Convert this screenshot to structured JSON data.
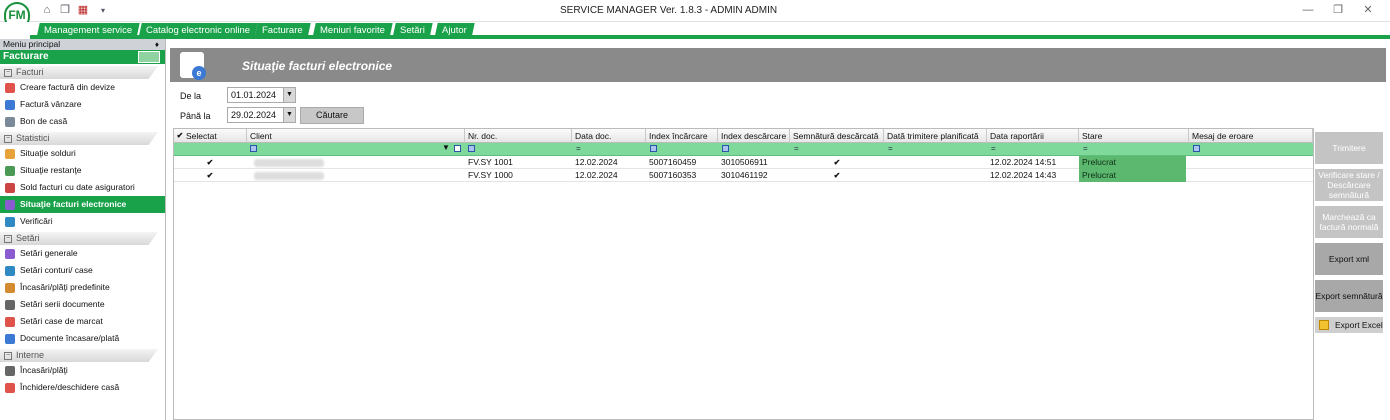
{
  "app": {
    "title": "SERVICE MANAGER Ver. 1.8.3 - ADMIN ADMIN",
    "logo_text": "FM",
    "quick_icons": [
      "home-icon",
      "copy-icon",
      "calendar-icon",
      "dropdown-icon"
    ]
  },
  "menu": [
    "Management service",
    "Catalog electronic online",
    "Facturare",
    "Meniuri favorite",
    "Setări",
    "Ajutor"
  ],
  "sidebar": {
    "header": "Meniu principal",
    "pin": "♦",
    "title": "Facturare",
    "groups": [
      {
        "label": "Facturi",
        "items": [
          "Creare factură din devize",
          "Factură vânzare",
          "Bon de casă"
        ]
      },
      {
        "label": "Statistici",
        "items": [
          "Situaţie solduri",
          "Situaţie restanţe",
          "Sold facturi cu date asiguratori",
          "Situaţie facturi electronice",
          "Verificări"
        ]
      },
      {
        "label": "Setări",
        "items": [
          "Setări generale",
          "Setări conturi/ case",
          "Încasări/plăţi predefinite",
          "Setări serii documente",
          "Setări case de marcat",
          "Documente încasare/plată"
        ]
      },
      {
        "label": "Interne",
        "items": [
          "Încasări/plăţi",
          "Închidere/deschidere casă"
        ]
      }
    ],
    "selected": "Situaţie facturi electronice"
  },
  "page": {
    "title": "Situaţie facturi electronice",
    "icon_letter": "e"
  },
  "filters": {
    "from_label": "De la",
    "from_value": "01.01.2024",
    "to_label": "Până la",
    "to_value": "29.02.2024",
    "search_button": "Căutare"
  },
  "grid": {
    "columns": [
      "Selectat",
      "Client",
      "Nr. doc.",
      "Data doc.",
      "Index încărcare",
      "Index descărcare",
      "Semnătură descărcată",
      "Dată trimitere planificată",
      "Data raportării",
      "Stare",
      "Mesaj de eroare"
    ],
    "filter_eq": "=",
    "rows": [
      {
        "nr": "FV.SY 1001",
        "data": "12.02.2024",
        "inc": "5007160459",
        "desc": "3010506911",
        "raport": "12.02.2024 14:51",
        "stare": "Prelucrat",
        "check": "✔"
      },
      {
        "nr": "FV.SY 1000",
        "data": "12.02.2024",
        "inc": "5007160353",
        "desc": "3010461192",
        "raport": "12.02.2024 14:43",
        "stare": "Prelucrat",
        "check": "✔"
      }
    ]
  },
  "actions": [
    "Trimitere",
    "Verificare stare / Descărcare semnătură",
    "Marchează ca factură normală",
    "Export xml",
    "Export semnătură",
    "Export Excel"
  ]
}
